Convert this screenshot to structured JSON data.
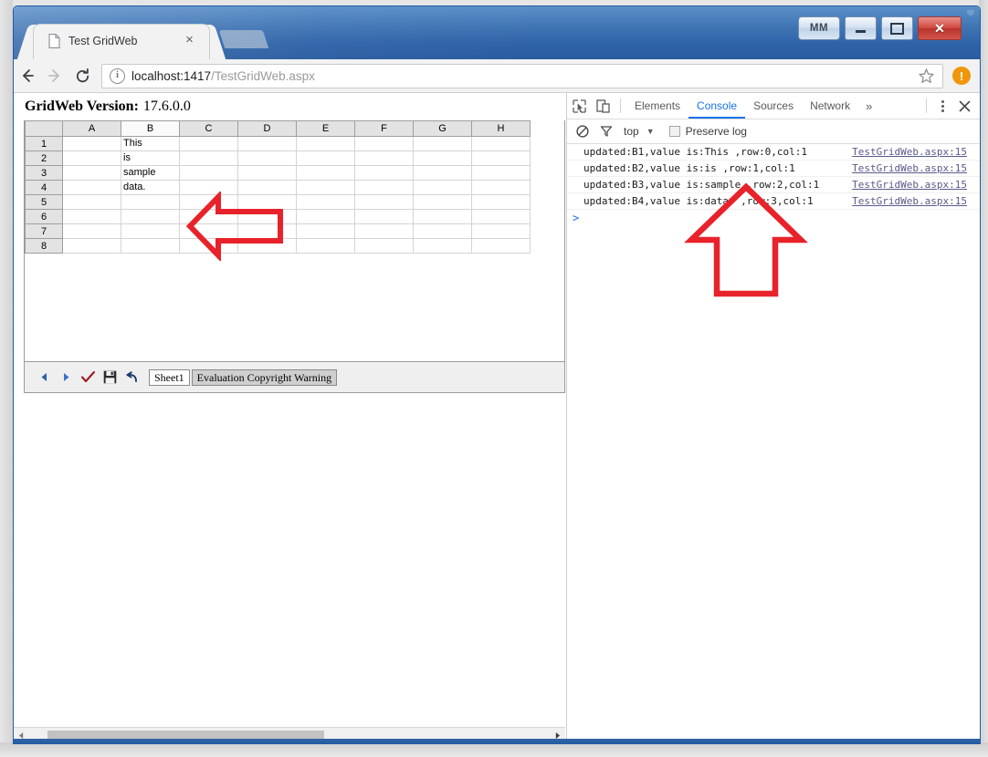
{
  "window": {
    "tab_title": "Test GridWeb",
    "tab_close_glyph": "×",
    "buttons": {
      "mm_label": "MM",
      "close_glyph": "✕"
    }
  },
  "navbar": {
    "url_host": "localhost:1417",
    "url_path": "/TestGridWeb.aspx",
    "info_glyph": "i",
    "warning_glyph": "!"
  },
  "page": {
    "title_label": "GridWeb Version:",
    "version": "17.6.0.0",
    "grid": {
      "columns": [
        "A",
        "B",
        "C",
        "D",
        "E",
        "F",
        "G",
        "H"
      ],
      "selected_column": "B",
      "rows": [
        {
          "header": "1",
          "cells": [
            "",
            "This",
            "",
            "",
            "",
            "",
            "",
            ""
          ]
        },
        {
          "header": "2",
          "cells": [
            "",
            "is",
            "",
            "",
            "",
            "",
            "",
            ""
          ]
        },
        {
          "header": "3",
          "cells": [
            "",
            "sample",
            "",
            "",
            "",
            "",
            "",
            ""
          ]
        },
        {
          "header": "4",
          "cells": [
            "",
            "data.",
            "",
            "",
            "",
            "",
            "",
            ""
          ]
        },
        {
          "header": "5",
          "cells": [
            "",
            "",
            "",
            "",
            "",
            "",
            "",
            ""
          ]
        },
        {
          "header": "6",
          "cells": [
            "",
            "",
            "",
            "",
            "",
            "",
            "",
            ""
          ]
        },
        {
          "header": "7",
          "cells": [
            "",
            "",
            "",
            "",
            "",
            "",
            "",
            ""
          ]
        },
        {
          "header": "8",
          "cells": [
            "",
            "",
            "",
            "",
            "",
            "",
            "",
            ""
          ]
        }
      ]
    },
    "toolbar": {
      "prev_label": "◀",
      "next_label": "▶",
      "submit_label": "✓",
      "save_label": "💾",
      "undo_label": "↶",
      "sheet_tab_active": "Sheet1",
      "sheet_tab_inactive": "Evaluation Copyright Warning"
    }
  },
  "devtools": {
    "tabs": [
      {
        "label": "Elements",
        "active": false
      },
      {
        "label": "Console",
        "active": true
      },
      {
        "label": "Sources",
        "active": false
      },
      {
        "label": "Network",
        "active": false
      }
    ],
    "more_glyph": "»",
    "close_glyph": "✕",
    "console_controls": {
      "context_label": "top",
      "caret_glyph": "▼",
      "preserve_log_label": "Preserve log",
      "preserve_log_checked": false
    },
    "messages": [
      {
        "text": "updated:B1,value is:This  ,row:0,col:1",
        "source": "TestGridWeb.aspx:15"
      },
      {
        "text": "updated:B2,value is:is  ,row:1,col:1",
        "source": "TestGridWeb.aspx:15"
      },
      {
        "text": "updated:B3,value is:sample  ,row:2,col:1",
        "source": "TestGridWeb.aspx:15"
      },
      {
        "text": "updated:B4,value is:data.  ,row:3,col:1",
        "source": "TestGridWeb.aspx:15"
      }
    ],
    "prompt_glyph": ">"
  },
  "colors": {
    "accent_blue": "#1a73e8",
    "titlebar_blue": "#2f63a8",
    "annotation_red": "#e8222a",
    "close_red": "#cf4a41",
    "warning_orange": "#f0960a"
  }
}
